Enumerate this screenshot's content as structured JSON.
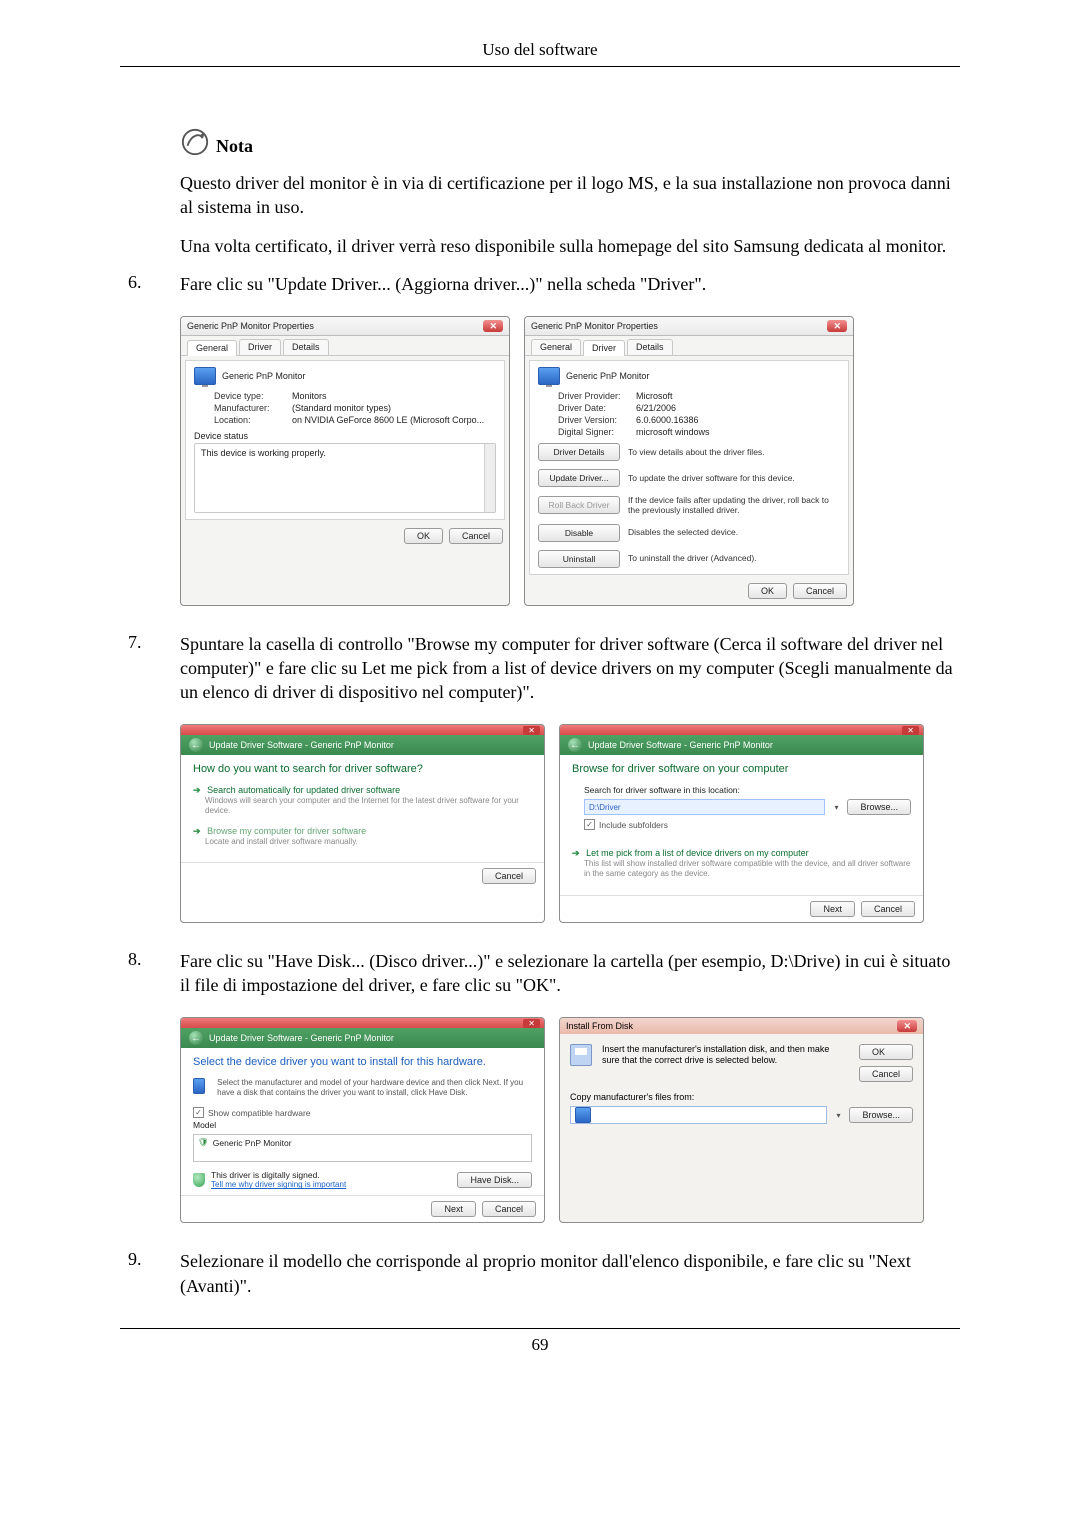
{
  "header": "Uso del software",
  "note_label": "Nota",
  "note_para1": "Questo driver del monitor è in via di certificazione per il logo MS, e la sua installazione non provoca danni al sistema in uso.",
  "note_para2": "Una volta certificato, il driver verrà reso disponibile sulla homepage del sito Samsung dedicata al monitor.",
  "step6_num": "6.",
  "step6_text": "Fare clic su \"Update Driver... (Aggiorna driver...)\" nella scheda \"Driver\".",
  "step7_num": "7.",
  "step7_text": "Spuntare la casella di controllo \"Browse my computer for driver software (Cerca il software del driver nel computer)\" e fare clic su Let me pick from a list of device drivers on my computer (Scegli manualmente da un elenco di driver di dispositivo nel computer)\".",
  "step8_num": "8.",
  "step8_text": "Fare clic su \"Have Disk... (Disco driver...)\" e selezionare la cartella (per esempio, D:\\Drive) in cui è situato il file di impostazione del driver, e fare clic su \"OK\".",
  "step9_num": "9.",
  "step9_text": "Selezionare il modello che corrisponde al proprio monitor dall'elenco disponibile, e fare clic su \"Next (Avanti)\".",
  "page_number": "69",
  "props_title": "Generic PnP Monitor Properties",
  "tabs": {
    "general": "General",
    "driver": "Driver",
    "details": "Details"
  },
  "device_name": "Generic PnP Monitor",
  "gen": {
    "device_type_k": "Device type:",
    "device_type_v": "Monitors",
    "manufacturer_k": "Manufacturer:",
    "manufacturer_v": "(Standard monitor types)",
    "location_k": "Location:",
    "location_v": "on NVIDIA GeForce 8600 LE (Microsoft Corpo..."
  },
  "device_status_label": "Device status",
  "device_status_text": "This device is working properly.",
  "buttons": {
    "ok": "OK",
    "cancel": "Cancel",
    "next": "Next",
    "browse": "Browse...",
    "have_disk": "Have Disk..."
  },
  "drv": {
    "provider_k": "Driver Provider:",
    "provider_v": "Microsoft",
    "date_k": "Driver Date:",
    "date_v": "6/21/2006",
    "version_k": "Driver Version:",
    "version_v": "6.0.6000.16386",
    "signer_k": "Digital Signer:",
    "signer_v": "microsoft windows"
  },
  "drv_btns": {
    "details": "Driver Details",
    "details_t": "To view details about the driver files.",
    "update": "Update Driver...",
    "update_t": "To update the driver software for this device.",
    "rollback": "Roll Back Driver",
    "rollback_t": "If the device fails after updating the driver, roll back to the previously installed driver.",
    "disable": "Disable",
    "disable_t": "Disables the selected device.",
    "uninstall": "Uninstall",
    "uninstall_t": "To uninstall the driver (Advanced)."
  },
  "wiz_bread": "Update Driver Software - Generic PnP Monitor",
  "wiz1": {
    "title": "How do you want to search for driver software?",
    "opt1_t": "Search automatically for updated driver software",
    "opt1_d": "Windows will search your computer and the Internet for the latest driver software for your device.",
    "opt2_t": "Browse my computer for driver software",
    "opt2_d": "Locate and install driver software manually."
  },
  "wiz2": {
    "title": "Browse for driver software on your computer",
    "search_label": "Search for driver software in this location:",
    "path_text": "D:\\Driver",
    "include_sub": "Include subfolders",
    "opt_t": "Let me pick from a list of device drivers on my computer",
    "opt_d": "This list will show installed driver software compatible with the device, and all driver software in the same category as the device."
  },
  "wiz3": {
    "title": "Select the device driver you want to install for this hardware.",
    "desc": "Select the manufacturer and model of your hardware device and then click Next. If you have a disk that contains the driver you want to install, click Have Disk.",
    "show_compat": "Show compatible hardware",
    "model_label": "Model",
    "model_item": "Generic PnP Monitor",
    "signed": "This driver is digitally signed.",
    "signed_link": "Tell me why driver signing is important"
  },
  "ifd": {
    "title": "Install From Disk",
    "msg": "Insert the manufacturer's installation disk, and then make sure that the correct drive is selected below.",
    "copy_label": "Copy manufacturer's files from:"
  }
}
